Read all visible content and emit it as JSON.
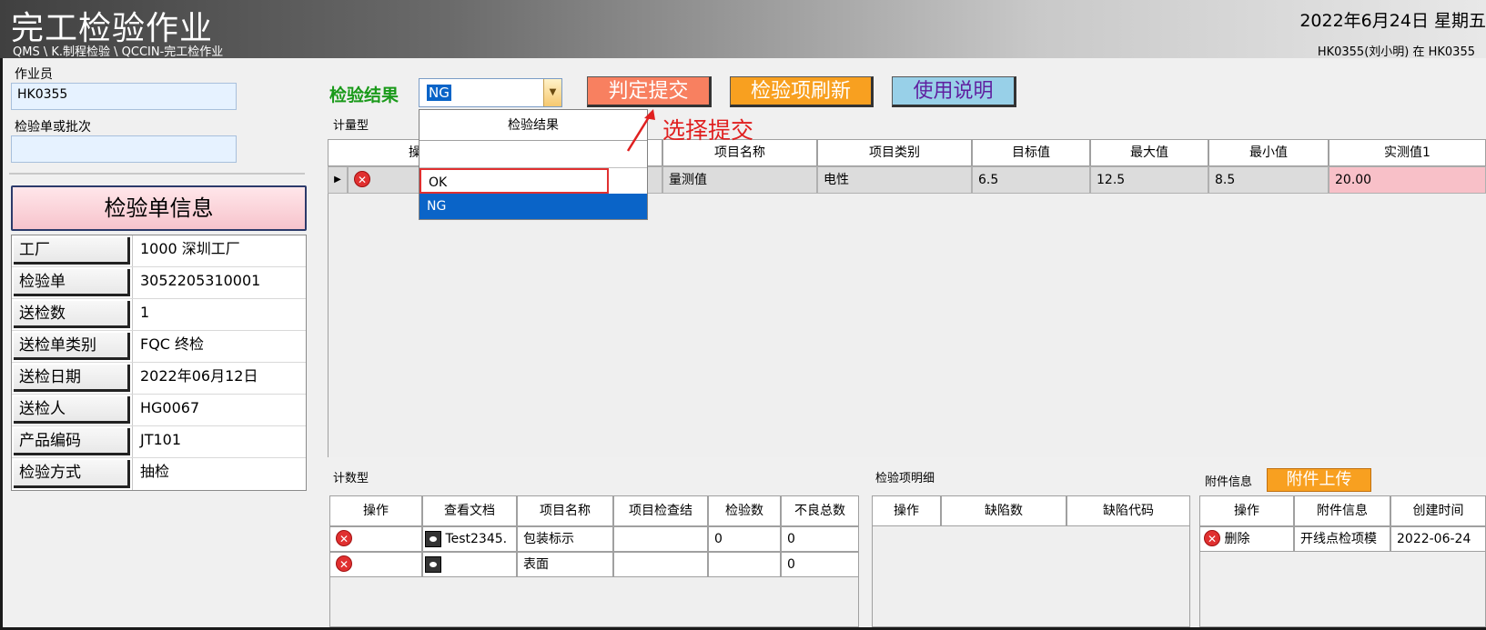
{
  "header": {
    "title": "完工检验作业",
    "breadcrumb": "QMS \\ K.制程检验 \\ QCCIN-完工检作业",
    "date": "2022年6月24日 星期五",
    "user": "HK0355(刘小明) 在 HK0355"
  },
  "left": {
    "operator_label": "作业员",
    "operator_value": "HK0355",
    "lot_label": "检验单或批次",
    "lot_value": "",
    "info_title": "检验单信息",
    "info_rows": [
      {
        "key": "工厂",
        "value": "1000 深圳工厂"
      },
      {
        "key": "检验单",
        "value": "3052205310001"
      },
      {
        "key": "送检数",
        "value": "1"
      },
      {
        "key": "送检单类别",
        "value": "FQC 终检"
      },
      {
        "key": "送检日期",
        "value": "2022年06月12日"
      },
      {
        "key": "送检人",
        "value": "HG0067"
      },
      {
        "key": "产品编码",
        "value": "JT101"
      },
      {
        "key": "检验方式",
        "value": "抽检"
      }
    ]
  },
  "toolbar": {
    "result_label": "检验结果",
    "result_value": "NG",
    "submit_label": "判定提交",
    "refresh_label": "检验项刷新",
    "help_label": "使用说明"
  },
  "dropdown": {
    "header": "检验结果",
    "options": [
      "OK",
      "NG"
    ],
    "selected": "NG"
  },
  "annotation": "选择提交",
  "measured": {
    "section_label": "计量型",
    "columns": [
      "操",
      "项目名称",
      "项目类别",
      "目标值",
      "最大值",
      "最小值",
      "实测值1"
    ],
    "row": {
      "name": "量测值",
      "category": "电性",
      "target": "6.5",
      "max": "12.5",
      "min": "8.5",
      "actual1": "20.00"
    },
    "colors": {
      "out_of_range": "#f8c0c8"
    }
  },
  "counted": {
    "section_label": "计数型",
    "columns": [
      "操作",
      "查看文档",
      "项目名称",
      "项目检查结",
      "检验数",
      "不良总数"
    ],
    "rows": [
      {
        "doc": "Test2345.",
        "name": "包装标示",
        "result": "",
        "qty": "0",
        "defects": "0"
      },
      {
        "doc": "",
        "name": "表面",
        "result": "",
        "qty": "",
        "defects": "0"
      }
    ]
  },
  "detail": {
    "section_label": "检验项明细",
    "columns": [
      "操作",
      "缺陷数",
      "缺陷代码"
    ]
  },
  "attachments": {
    "section_label": "附件信息",
    "upload_label": "附件上传",
    "columns": [
      "操作",
      "附件信息",
      "创建时间"
    ],
    "rows": [
      {
        "action": "删除",
        "info": "开线点检项模",
        "created": "2022-06-24"
      }
    ]
  }
}
